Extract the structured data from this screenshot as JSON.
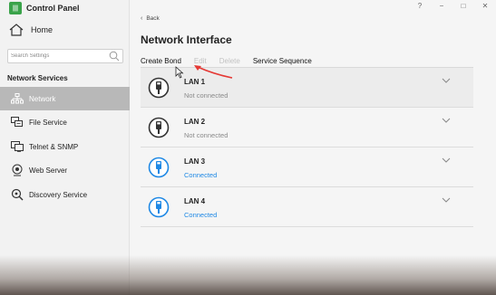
{
  "app": {
    "title": "Control Panel",
    "logo_text": "|||"
  },
  "window_controls": {
    "help": "?",
    "minimize": "−",
    "maximize": "□",
    "close": "✕"
  },
  "sidebar": {
    "home_label": "Home",
    "search_placeholder": "Search Settings",
    "section_title": "Network Services",
    "items": [
      {
        "label": "Network",
        "icon": "network-icon",
        "active": true
      },
      {
        "label": "File Service",
        "icon": "file-service-icon",
        "active": false
      },
      {
        "label": "Telnet & SNMP",
        "icon": "telnet-icon",
        "active": false
      },
      {
        "label": "Web Server",
        "icon": "web-server-icon",
        "active": false
      },
      {
        "label": "Discovery Service",
        "icon": "discovery-icon",
        "active": false
      }
    ]
  },
  "main": {
    "back_label": "Back",
    "page_title": "Network Interface",
    "toolbar": {
      "create_bond": "Create Bond",
      "edit": "Edit",
      "delete": "Delete",
      "service_sequence": "Service Sequence"
    },
    "interfaces": [
      {
        "name": "LAN 1",
        "status": "Not connected",
        "connected": false
      },
      {
        "name": "LAN 2",
        "status": "Not connected",
        "connected": false
      },
      {
        "name": "LAN 3",
        "status": "Connected",
        "connected": true
      },
      {
        "name": "LAN 4",
        "status": "Connected",
        "connected": true
      }
    ]
  },
  "colors": {
    "accent": "#1e88e5",
    "sidebar_active": "#b8b8b8",
    "disconnected_icon": "#333333",
    "logo": "#3aa34a",
    "annotation_arrow": "#e53935"
  }
}
